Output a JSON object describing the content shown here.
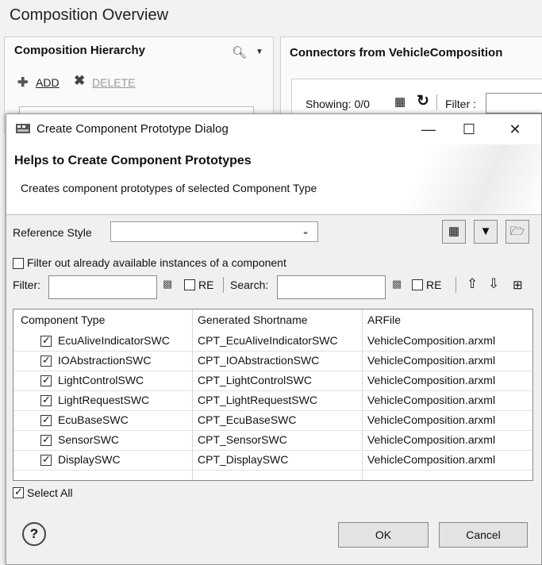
{
  "background": {
    "title": "Composition Overview",
    "left_panel": {
      "header": "Composition Hierarchy",
      "add_label": "ADD",
      "delete_label": "DELETE"
    },
    "right_panel": {
      "header": "Connectors  from VehicleComposition",
      "showing": "Showing: 0/0",
      "filter_label": "Filter :"
    }
  },
  "dialog": {
    "title": "Create Component Prototype Dialog",
    "heading": "Helps to Create Component Prototypes",
    "description": "Creates component prototypes of selected Component Type",
    "reference_style_label": "Reference Style",
    "reference_style_value": "",
    "filter_out_label": "Filter out already available instances of a component",
    "filter_out_checked": false,
    "filter_label": "Filter:",
    "filter_value": "",
    "re_label_1": "RE",
    "search_label": "Search:",
    "search_value": "",
    "re_label_2": "RE",
    "columns": [
      "Component Type",
      "Generated Shortname",
      "ARFile"
    ],
    "rows": [
      {
        "type": "EcuAliveIndicatorSWC",
        "shortname": "CPT_EcuAliveIndicatorSWC",
        "arfile": "VehicleComposition.arxml",
        "checked": true
      },
      {
        "type": "IOAbstractionSWC",
        "shortname": "CPT_IOAbstractionSWC",
        "arfile": "VehicleComposition.arxml",
        "checked": true
      },
      {
        "type": "LightControlSWC",
        "shortname": "CPT_LightControlSWC",
        "arfile": "VehicleComposition.arxml",
        "checked": true
      },
      {
        "type": "LightRequestSWC",
        "shortname": "CPT_LightRequestSWC",
        "arfile": "VehicleComposition.arxml",
        "checked": true
      },
      {
        "type": "EcuBaseSWC",
        "shortname": "CPT_EcuBaseSWC",
        "arfile": "VehicleComposition.arxml",
        "checked": true
      },
      {
        "type": "SensorSWC",
        "shortname": "CPT_SensorSWC",
        "arfile": "VehicleComposition.arxml",
        "checked": true
      },
      {
        "type": "DisplaySWC",
        "shortname": "CPT_DisplaySWC",
        "arfile": "VehicleComposition.arxml",
        "checked": true
      }
    ],
    "select_all_label": "Select All",
    "select_all_checked": true,
    "ok_label": "OK",
    "cancel_label": "Cancel",
    "help_glyph": "?"
  }
}
